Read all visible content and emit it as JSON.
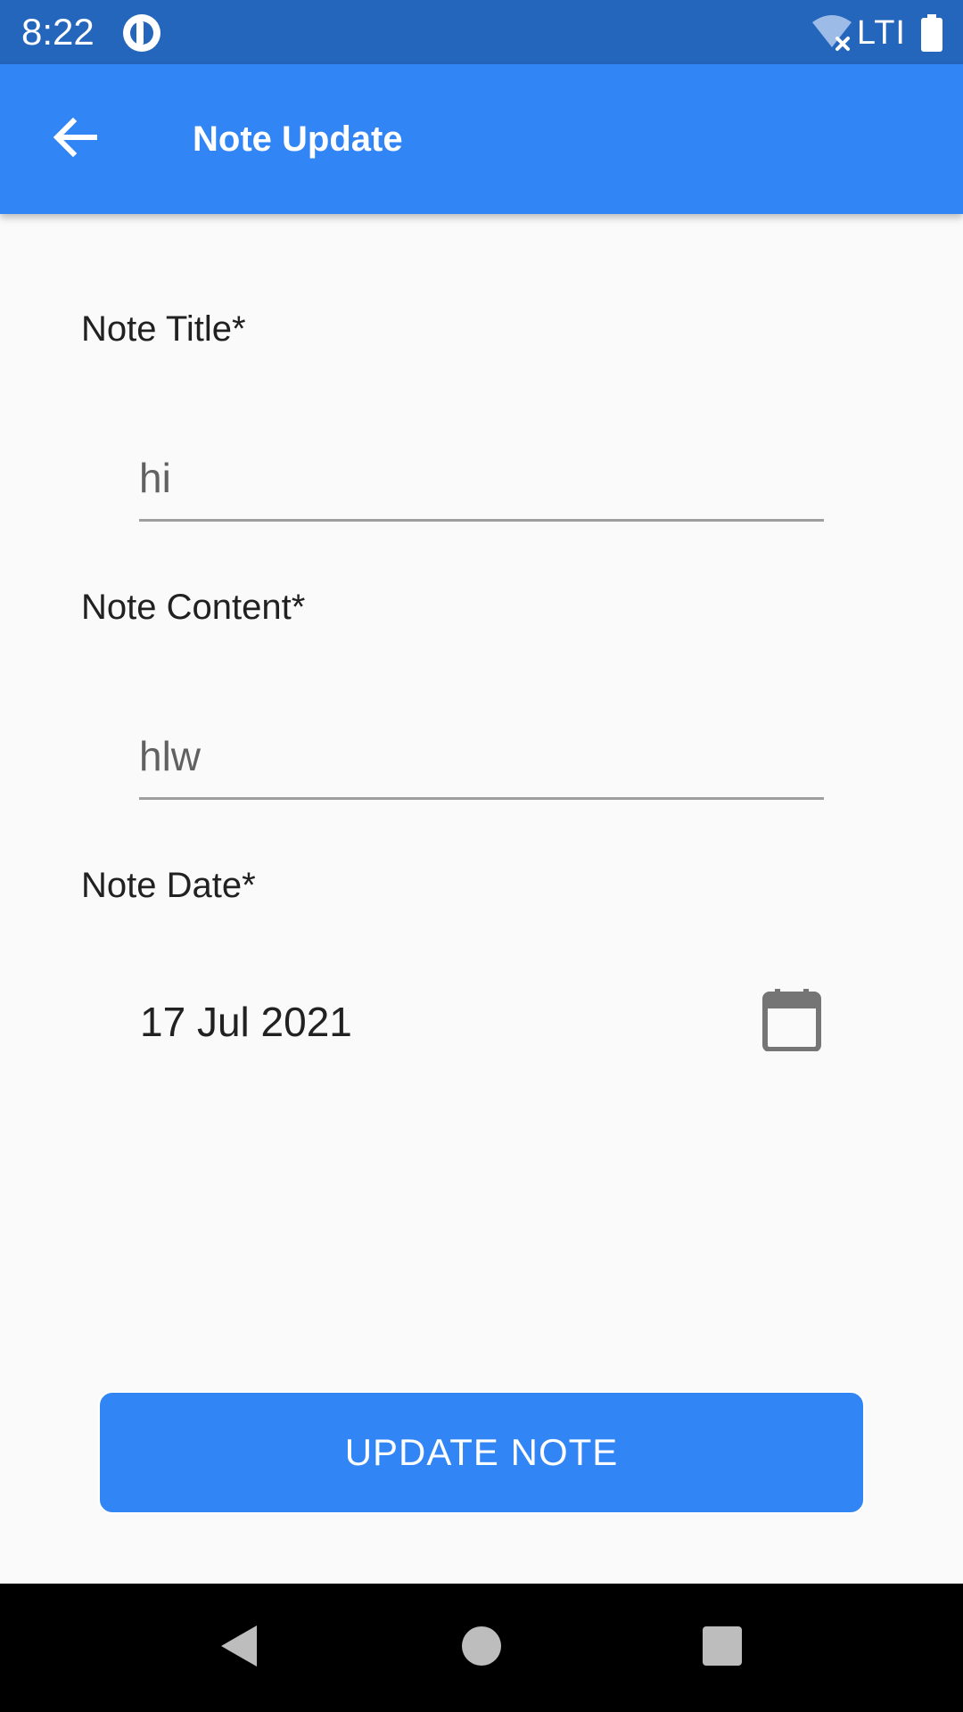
{
  "status_bar": {
    "time": "8:22",
    "network": "LTI",
    "icons": [
      "app-notification-icon",
      "wifi-off-icon",
      "battery-icon"
    ]
  },
  "app_bar": {
    "title": "Note Update",
    "back_icon": "arrow-back-icon"
  },
  "form": {
    "title_label": "Note Title*",
    "title_value": "hi",
    "content_label": "Note Content*",
    "content_value": "hlw",
    "date_label": "Note Date*",
    "date_value": "17 Jul 2021",
    "date_icon": "calendar-icon"
  },
  "actions": {
    "update_label": "UPDATE NOTE"
  },
  "nav_bar": {
    "icons": [
      "back-triangle-icon",
      "home-circle-icon",
      "recents-square-icon"
    ]
  },
  "colors": {
    "status_bar": "#2566bd",
    "primary": "#3285f5",
    "background": "#fafafa",
    "nav_bar": "#000000"
  }
}
